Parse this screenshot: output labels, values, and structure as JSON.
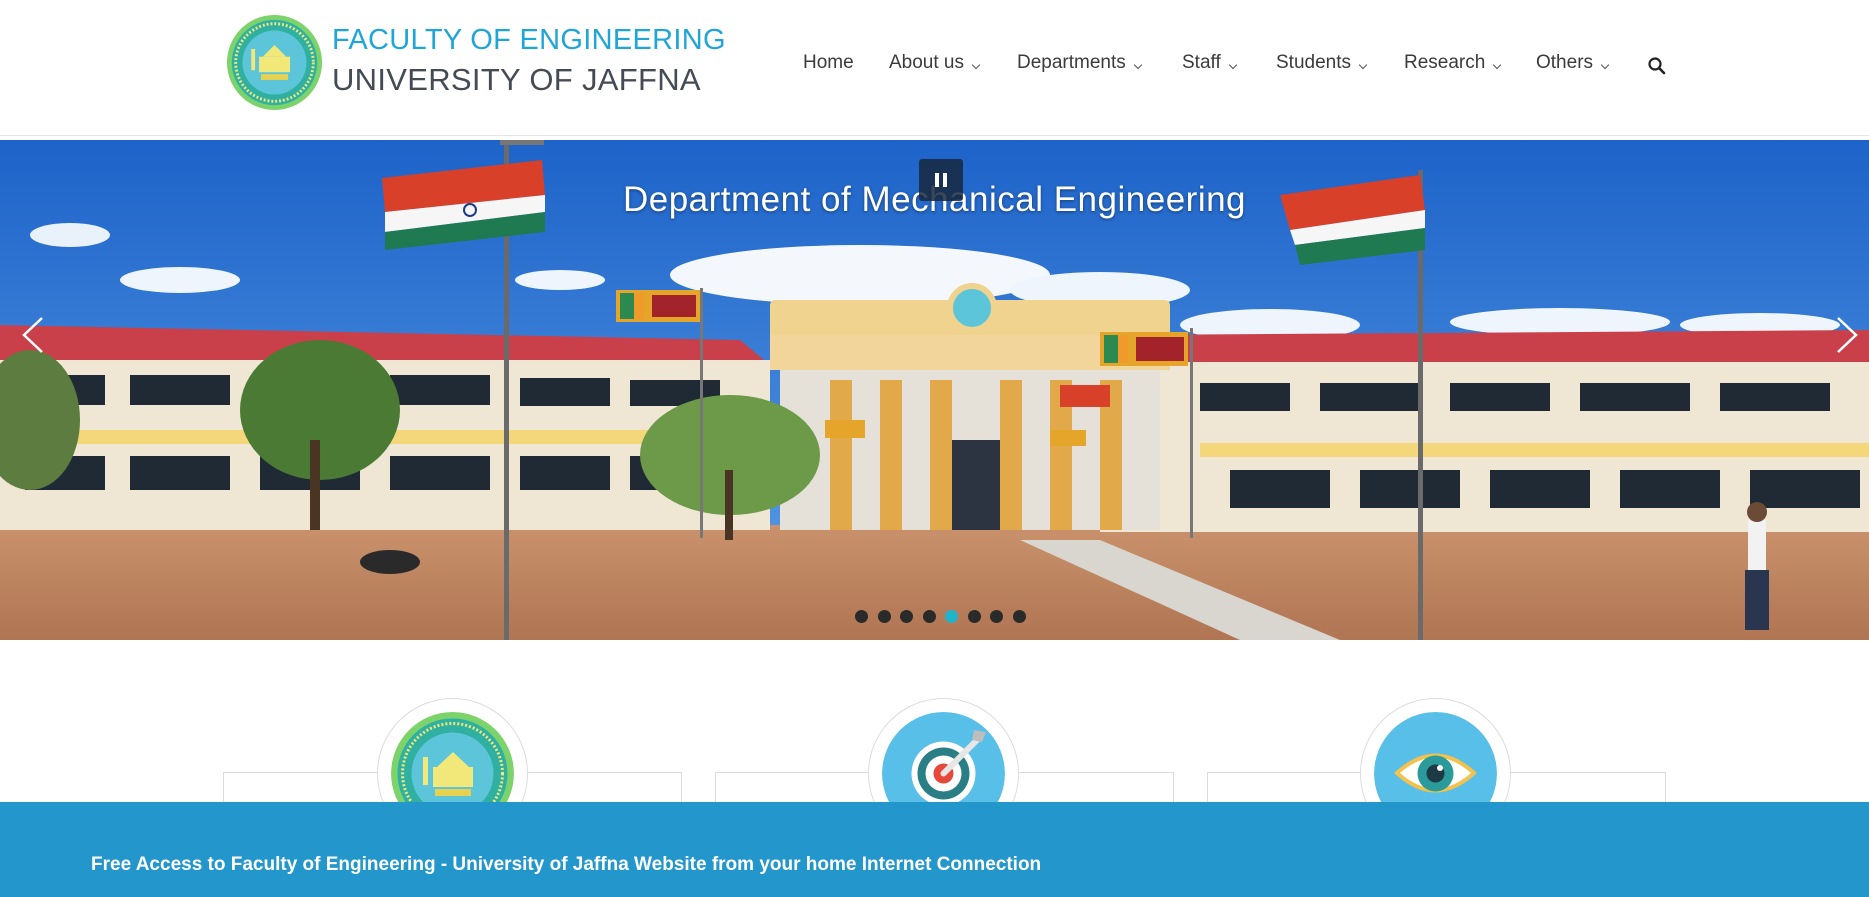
{
  "header": {
    "brand_line1": "FACULTY OF ENGINEERING",
    "brand_line2": "UNIVERSITY OF JAFFNA",
    "logo_icon": "university-seal-icon"
  },
  "nav": {
    "items": [
      {
        "label": "Home",
        "has_dropdown": false
      },
      {
        "label": "About us",
        "has_dropdown": true
      },
      {
        "label": "Departments",
        "has_dropdown": true
      },
      {
        "label": "Staff",
        "has_dropdown": true
      },
      {
        "label": "Students",
        "has_dropdown": true
      },
      {
        "label": "Research",
        "has_dropdown": true
      },
      {
        "label": "Others",
        "has_dropdown": true
      }
    ],
    "search_icon": "search-icon"
  },
  "hero": {
    "slide_title": "Department of Mechanical Engineering",
    "pause_icon": "pause-icon",
    "prev_icon": "chevron-left-icon",
    "next_icon": "chevron-right-icon",
    "slide_count": 8,
    "active_slide": 5
  },
  "cards": [
    {
      "icon": "university-seal-icon"
    },
    {
      "icon": "target-icon"
    },
    {
      "icon": "eye-icon"
    }
  ],
  "banner": {
    "text": "Free Access to Faculty of Engineering - University of Jaffna Website from your home Internet Connection"
  },
  "colors": {
    "brand_blue": "#20a5d8",
    "brand_dark": "#444b55",
    "banner_bg": "#2397cb",
    "active_dot": "#20b4cc"
  }
}
